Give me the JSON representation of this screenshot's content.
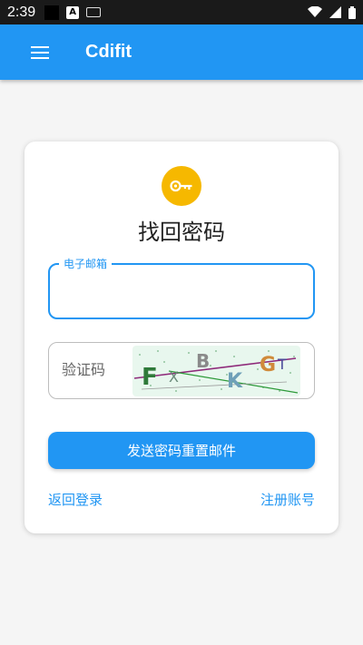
{
  "status_bar": {
    "time": "2:39",
    "notification_label": "A"
  },
  "app_bar": {
    "title": "Cdifit"
  },
  "form": {
    "title": "找回密码",
    "email_label": "电子邮箱",
    "email_value": "",
    "captcha_placeholder": "验证码",
    "captcha_text": "FXBKGT",
    "send_button_label": "发送密码重置邮件",
    "back_to_login_label": "返回登录",
    "register_label": "注册账号"
  },
  "colors": {
    "primary": "#2196f3",
    "key_badge": "#f6b800"
  }
}
